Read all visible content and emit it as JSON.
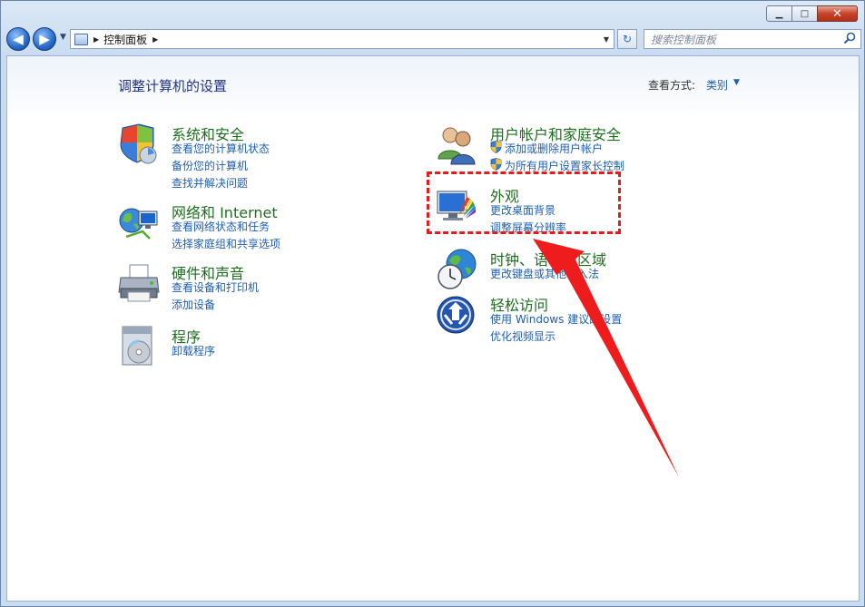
{
  "window": {
    "minimize_glyph": "▁",
    "maximize_glyph": "□",
    "close_glyph": "✕"
  },
  "nav": {
    "back_glyph": "◀",
    "forward_glyph": "▶",
    "recent_glyph": "▼",
    "breadcrumb_sep": "▶",
    "breadcrumb": "控制面板",
    "breadcrumb_tail_sep": "▶",
    "address_dropdown_glyph": "▼",
    "refresh_glyph": "↻",
    "search_placeholder": "搜索控制面板"
  },
  "header": {
    "title": "调整计算机的设置",
    "view_by_label": "查看方式:",
    "view_by_value": "类别",
    "view_by_arrow": "▼"
  },
  "categories_left": [
    {
      "title": "系统和安全",
      "icon": "shield-system-icon",
      "links": [
        "查看您的计算机状态",
        "备份您的计算机",
        "查找并解决问题"
      ]
    },
    {
      "title": "网络和 Internet",
      "icon": "network-globe-icon",
      "links": [
        "查看网络状态和任务",
        "选择家庭组和共享选项"
      ]
    },
    {
      "title": "硬件和声音",
      "icon": "printer-icon",
      "links": [
        "查看设备和打印机",
        "添加设备"
      ]
    },
    {
      "title": "程序",
      "icon": "programs-disc-icon",
      "links": [
        "卸载程序"
      ]
    }
  ],
  "categories_right": [
    {
      "title": "用户帐户和家庭安全",
      "icon": "users-icon",
      "links": [
        "添加或删除用户帐户",
        "为所有用户设置家长控制"
      ]
    },
    {
      "title": "外观",
      "icon": "monitor-palette-icon",
      "links": [
        "更改桌面背景",
        "调整屏幕分辨率"
      ]
    },
    {
      "title": "时钟、语言和区域",
      "icon": "clock-globe-icon",
      "links": [
        "更改键盘或其他输入法"
      ]
    },
    {
      "title": "轻松访问",
      "icon": "ease-of-access-icon",
      "links": [
        "使用 Windows 建议的设置",
        "优化视频显示"
      ]
    }
  ],
  "colors": {
    "category_title": "#1e6e1f",
    "link": "#1f5fb0",
    "page_title": "#1e3287",
    "annotation": "#e61c1c"
  }
}
